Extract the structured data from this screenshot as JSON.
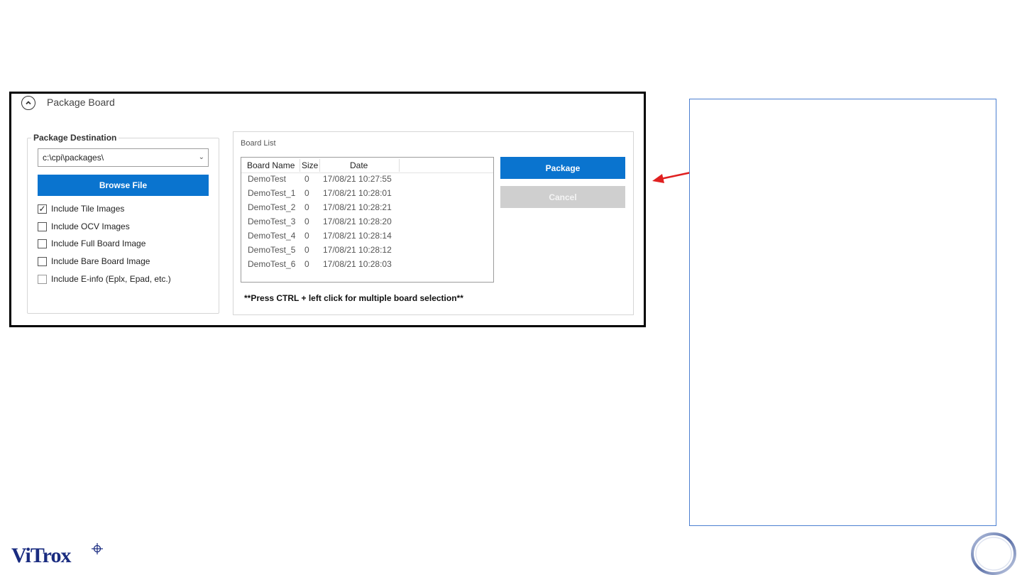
{
  "panel": {
    "title": "Package Board"
  },
  "destination": {
    "legend": "Package Destination",
    "path": "c:\\cpi\\packages\\",
    "browse_label": "Browse File",
    "options": [
      {
        "label": "Include Tile Images",
        "checked": true
      },
      {
        "label": "Include OCV Images",
        "checked": false
      },
      {
        "label": "Include Full Board Image",
        "checked": false
      },
      {
        "label": "Include Bare Board Image",
        "checked": false
      },
      {
        "label": "Include E-info (Eplx, Epad, etc.)",
        "checked": false
      }
    ]
  },
  "board_list": {
    "legend": "Board List",
    "columns": [
      "Board Name",
      "Size",
      "Date"
    ],
    "rows": [
      {
        "name": "DemoTest",
        "size": "0",
        "date": "17/08/21 10:27:55"
      },
      {
        "name": "DemoTest_1",
        "size": "0",
        "date": "17/08/21 10:28:01"
      },
      {
        "name": "DemoTest_2",
        "size": "0",
        "date": "17/08/21 10:28:21"
      },
      {
        "name": "DemoTest_3",
        "size": "0",
        "date": "17/08/21 10:28:20"
      },
      {
        "name": "DemoTest_4",
        "size": "0",
        "date": "17/08/21 10:28:14"
      },
      {
        "name": "DemoTest_5",
        "size": "0",
        "date": "17/08/21 10:28:12"
      },
      {
        "name": "DemoTest_6",
        "size": "0",
        "date": "17/08/21 10:28:03"
      }
    ],
    "hint": "**Press CTRL + left click for multiple board selection**"
  },
  "actions": {
    "package_label": "Package",
    "cancel_label": "Cancel"
  },
  "brand": {
    "logo_text": "ViTrox",
    "primary_color": "#0a74cf",
    "arrow_color": "#e02020"
  }
}
